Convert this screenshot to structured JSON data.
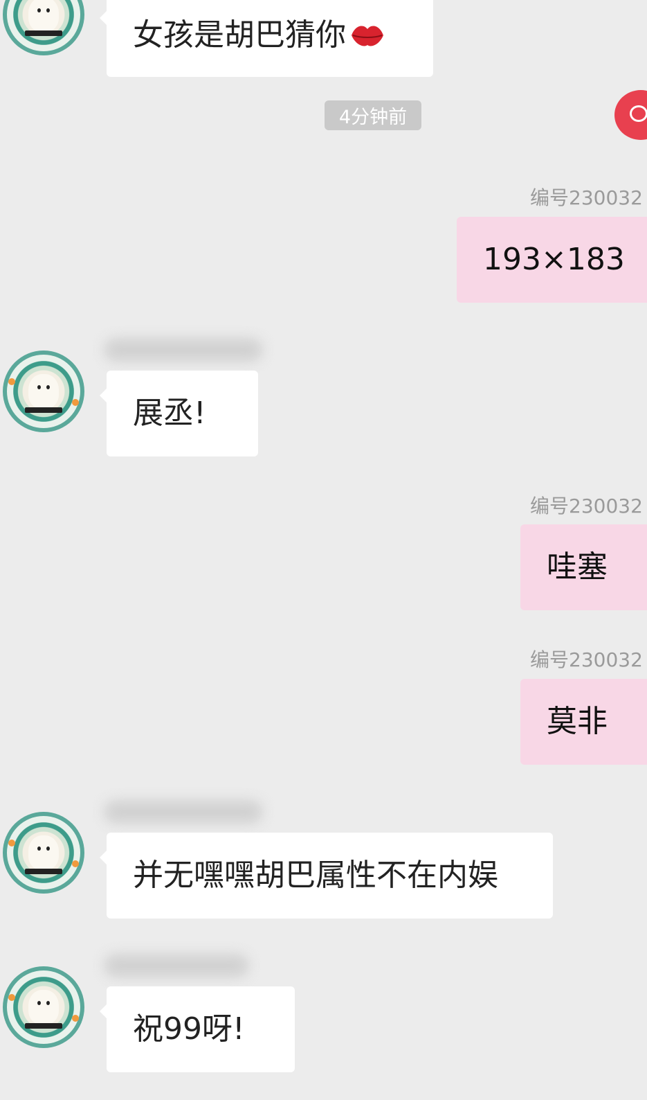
{
  "messages": [
    {
      "id": "m1",
      "side": "left",
      "text": "女孩是胡巴猜你",
      "emoji": "lips-icon"
    },
    {
      "id": "ts",
      "text": "4分钟前"
    },
    {
      "id": "m2",
      "side": "right",
      "sender": "编号230032",
      "text": "193×183"
    },
    {
      "id": "m3",
      "side": "left",
      "text": "展丞!"
    },
    {
      "id": "m4",
      "side": "right",
      "sender": "编号230032",
      "text": "哇塞"
    },
    {
      "id": "m5",
      "side": "right",
      "sender": "编号230032",
      "text": "莫非"
    },
    {
      "id": "m6",
      "side": "left",
      "text": "并无嘿嘿胡巴属性不在内娱"
    },
    {
      "id": "m7",
      "side": "left",
      "text": "祝99呀!"
    }
  ],
  "colors": {
    "background": "#ececec",
    "incoming_bubble": "#ffffff",
    "outgoing_bubble": "#f8d7e6",
    "timestamp_bg": "#c9c9c9",
    "accent": "#e8404f"
  },
  "icons": {
    "floating_button": "chat-icon",
    "avatar": "avatar-image"
  }
}
